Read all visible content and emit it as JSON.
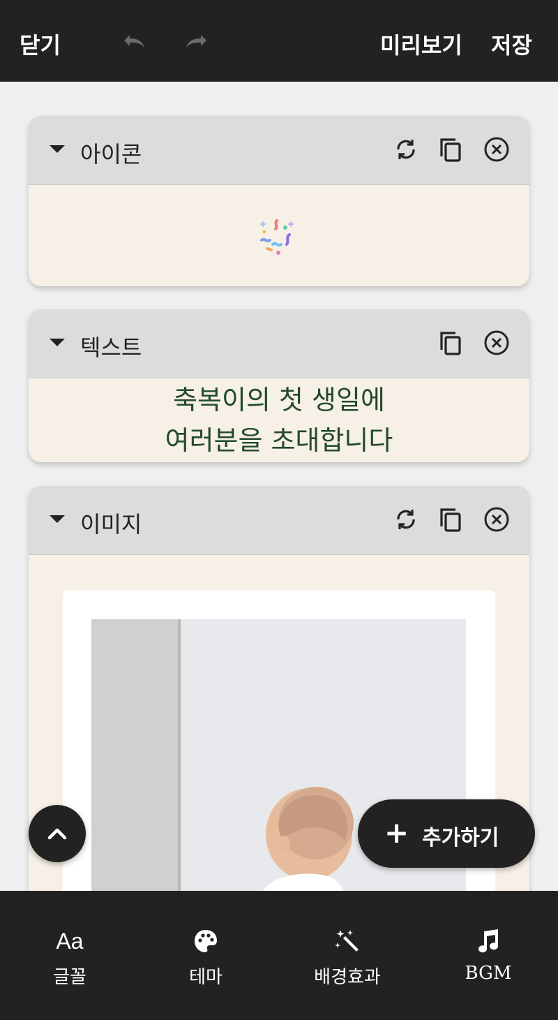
{
  "topbar": {
    "close_label": "닫기",
    "undo_icon": "undo-icon",
    "redo_icon": "redo-icon",
    "preview_label": "미리보기",
    "save_label": "저장"
  },
  "cards": {
    "icon": {
      "title": "아이콘",
      "content_icon": "confetti-icon"
    },
    "text": {
      "title": "텍스트",
      "body_line1": "축복이의 첫 생일에",
      "body_line2": "여러분을 초대합니다",
      "body_color": "#234a2a"
    },
    "image": {
      "title": "이미지"
    }
  },
  "fab": {
    "scroll_top_icon": "chevron-up-icon",
    "add_plus": "+",
    "add_label": "추가하기"
  },
  "bottom_nav": [
    {
      "icon_text": "Aa",
      "label": "글꼴"
    },
    {
      "icon": "palette-icon",
      "label": "테마"
    },
    {
      "icon": "magic-wand-icon",
      "label": "배경효과"
    },
    {
      "icon": "music-note-icon",
      "label": "BGM"
    }
  ],
  "colors": {
    "bar_bg": "#222222",
    "page_bg": "#efefef",
    "card_header_bg": "#dcdcdc",
    "card_body_bg": "#f7f0e7"
  }
}
